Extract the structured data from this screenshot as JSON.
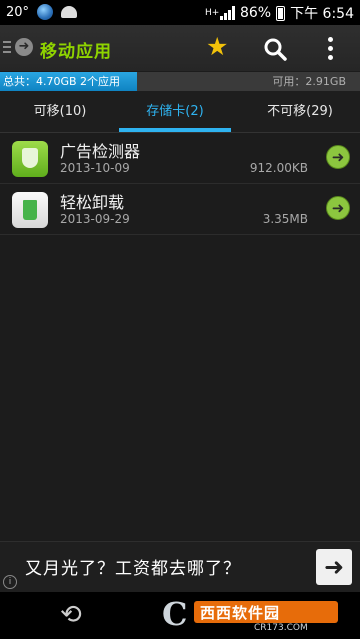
{
  "status_bar": {
    "temperature": "20°",
    "network_type": "H+",
    "battery_percent": "86%",
    "time": "下午 6:54"
  },
  "action_bar": {
    "title": "移动应用",
    "icons": [
      "menu-icon",
      "back-circle-icon",
      "star-icon",
      "search-icon",
      "overflow-icon"
    ],
    "accent_color": "#8fd400"
  },
  "storage": {
    "total_label": "总共：4.70GB  2个应用",
    "free_label": "可用：2.91GB",
    "used_fraction": 0.38,
    "bar_color": "#1a95d4"
  },
  "tabs": [
    {
      "label": "可移(10)",
      "active": false
    },
    {
      "label": "存储卡(2)",
      "active": true
    },
    {
      "label": "不可移(29)",
      "active": false
    }
  ],
  "apps": [
    {
      "name": "广告检测器",
      "date": "2013-10-09",
      "size": "912.00KB",
      "icon": "shield-icon"
    },
    {
      "name": "轻松卸载",
      "date": "2013-09-29",
      "size": "3.35MB",
      "icon": "trash-icon"
    }
  ],
  "ad": {
    "text": "又月光了？工资都去哪了？",
    "info_label": "i",
    "button_label": "➜"
  },
  "watermark": {
    "logo": "C",
    "title": "西西软件园",
    "url": "CR173.COM"
  }
}
